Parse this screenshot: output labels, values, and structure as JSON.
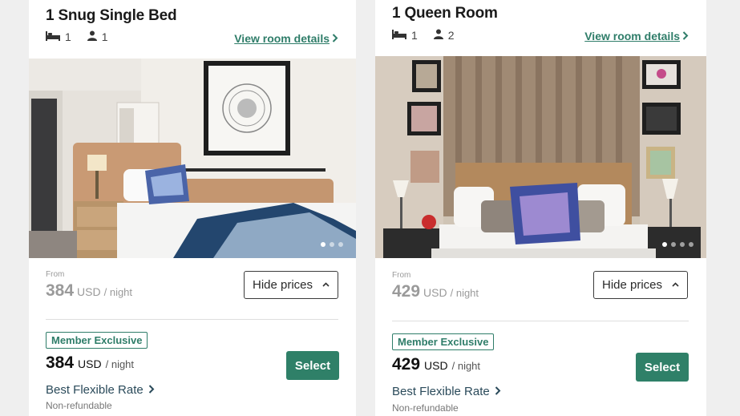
{
  "rooms": [
    {
      "title": "1 Snug Single Bed",
      "beds": "1",
      "guests": "1",
      "details_link": "View room details",
      "photo": {
        "slides": 3,
        "active_slide": 1
      },
      "from_label": "From",
      "from_price": "384",
      "from_currency": "USD",
      "per_night": "/ night",
      "hide_prices_label": "Hide prices",
      "rate": {
        "badge": "Member Exclusive",
        "price": "384",
        "currency": "USD",
        "per_night": "/ night",
        "select_label": "Select",
        "name": "Best Flexible Rate",
        "note": "Non-refundable"
      }
    },
    {
      "title": "1 Queen Room",
      "beds": "1",
      "guests": "2",
      "details_link": "View room details",
      "photo": {
        "slides": 4,
        "active_slide": 1
      },
      "from_label": "From",
      "from_price": "429",
      "from_currency": "USD",
      "per_night": "/ night",
      "hide_prices_label": "Hide prices",
      "rate": {
        "badge": "Member Exclusive",
        "price": "429",
        "currency": "USD",
        "per_night": "/ night",
        "select_label": "Select",
        "name": "Best Flexible Rate",
        "note": "Non-refundable"
      }
    }
  ],
  "icons": {
    "bed": "bed-icon",
    "guest": "person-icon",
    "chevron_right": "chevron-right-icon",
    "chevron_up": "chevron-up-icon"
  },
  "colors": {
    "accent": "#2f8068",
    "link": "#2f7d69",
    "muted_price": "#9a9a9a",
    "background": "#efefef"
  }
}
